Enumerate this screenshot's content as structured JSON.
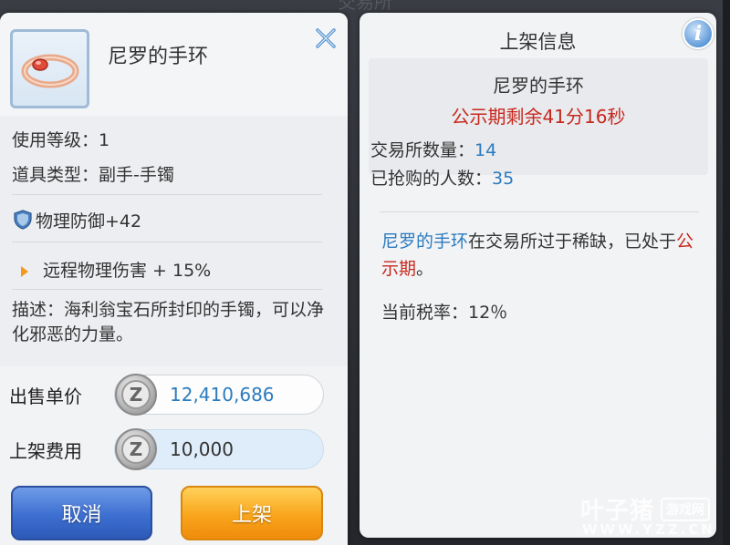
{
  "background": {
    "title": "交易所"
  },
  "item": {
    "name": "尼罗的手环",
    "icon": "bracelet-icon",
    "level_row": "使用等级：1",
    "type_row": "道具类型：副手-手镯",
    "defense_row": "物理防御+42",
    "defense_icon": "shield-icon",
    "bonus_row": "远程物理伤害 + 15%",
    "description": "描述：海利翁宝石所封印的手镯，可以净化邪恶的力量。"
  },
  "pricing": {
    "sell_label": "出售单价",
    "sell_value": "12,410,686",
    "fee_label": "上架费用",
    "fee_value": "10,000",
    "coin_glyph": "Z"
  },
  "actions": {
    "cancel_label": "取消",
    "list_label": "上架"
  },
  "listing_info": {
    "title": "上架信息",
    "info_glyph": "i",
    "item_name": "尼罗的手环",
    "period_remaining": "公示期剩余41分16秒",
    "exchange_count_label": "交易所数量：",
    "exchange_count": "14",
    "buyers_label": "已抢购的人数：",
    "buyers_count": "35",
    "notice_item": "尼罗的手环",
    "notice_mid": "在交易所过于稀缺，已处于",
    "notice_period": "公示期",
    "notice_end": "。",
    "tax_rate": "当前税率：12％"
  },
  "watermark": {
    "main": "叶子猪",
    "badge": "游戏网",
    "url": "WWW.YZZ.CN"
  },
  "colors": {
    "accent_blue": "#2b7bbf",
    "alert_red": "#c8281e",
    "cancel_blue": "#3d6fd1",
    "confirm_orange": "#f9a51b"
  }
}
